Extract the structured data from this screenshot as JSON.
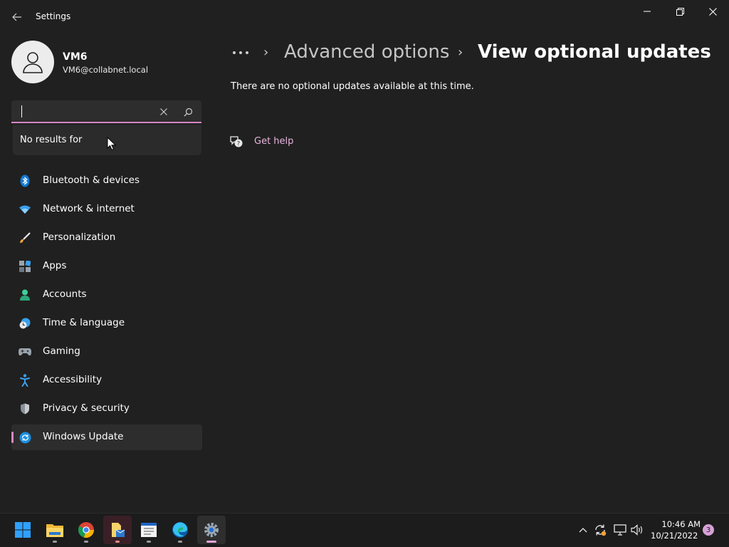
{
  "window": {
    "title": "Settings"
  },
  "profile": {
    "name": "VM6",
    "email": "VM6@collabnet.local"
  },
  "search": {
    "value": "",
    "placeholder": "",
    "no_results": "No results for"
  },
  "nav": {
    "items": [
      {
        "label": "Bluetooth & devices",
        "icon": "bluetooth-icon"
      },
      {
        "label": "Network & internet",
        "icon": "wifi-icon"
      },
      {
        "label": "Personalization",
        "icon": "brush-icon"
      },
      {
        "label": "Apps",
        "icon": "apps-icon"
      },
      {
        "label": "Accounts",
        "icon": "person-icon"
      },
      {
        "label": "Time & language",
        "icon": "clock-globe-icon"
      },
      {
        "label": "Gaming",
        "icon": "gamepad-icon"
      },
      {
        "label": "Accessibility",
        "icon": "accessibility-icon"
      },
      {
        "label": "Privacy & security",
        "icon": "shield-icon"
      },
      {
        "label": "Windows Update",
        "icon": "update-icon",
        "selected": true
      }
    ]
  },
  "breadcrumb": {
    "parent": "Advanced options",
    "current": "View optional updates",
    "separator": "›"
  },
  "main": {
    "status": "There are no optional updates available at this time.",
    "help_label": "Get help"
  },
  "taskbar": {
    "apps": [
      "start",
      "file-explorer",
      "chrome",
      "file-manager",
      "notepad",
      "edge",
      "settings"
    ],
    "time": "10:46 AM",
    "date": "10/21/2022",
    "notification_count": "3"
  },
  "colors": {
    "accent": "#d987c6",
    "background": "#202020",
    "link": "#e7b5de"
  }
}
